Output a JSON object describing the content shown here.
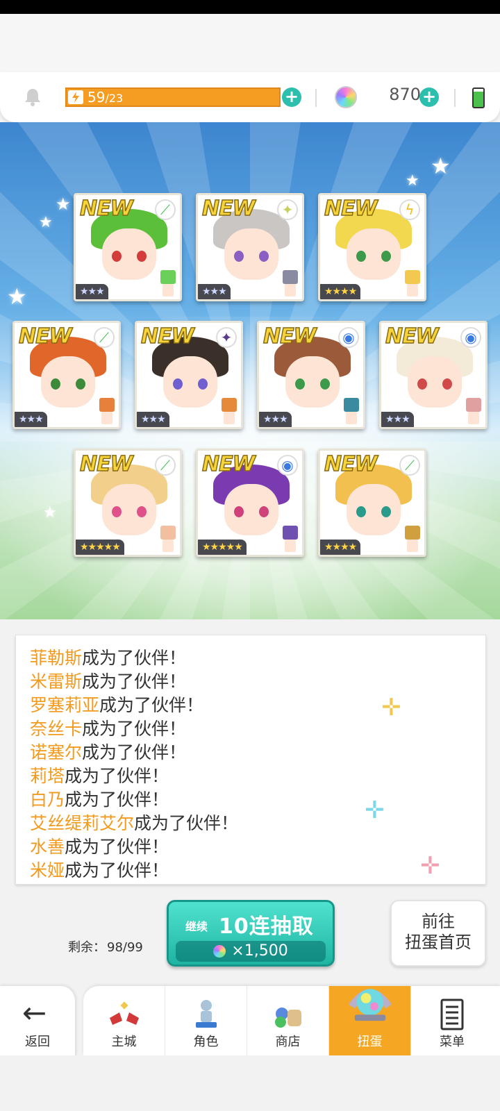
{
  "hud": {
    "energy_current": "59",
    "energy_max": "/23",
    "gem_count": "870",
    "colors": {
      "energy": "#f59d22",
      "plus": "#2dbfae"
    },
    "icons": [
      "bell-icon",
      "lightning-icon",
      "plus-icon",
      "gem-icon",
      "battery-icon"
    ]
  },
  "cards": [
    {
      "new": "NEW",
      "stars": "★★★",
      "element": "leaf",
      "hair": "#5bbf3a",
      "eye": "#d43b3b",
      "sprite": "#6ad05a"
    },
    {
      "new": "NEW",
      "stars": "★★★",
      "element": "sparkle",
      "hair": "#c9c6c4",
      "eye": "#8a5fc4",
      "sprite": "#8a8aa0"
    },
    {
      "new": "NEW",
      "stars": "★★★★",
      "element": "lightning",
      "hair": "#f2d84e",
      "eye": "#3c9a4a",
      "sprite": "#f2c94e"
    },
    {
      "new": "NEW",
      "stars": "★★★",
      "element": "leaf",
      "hair": "#e1662a",
      "eye": "#3c8a3a",
      "sprite": "#e6803a"
    },
    {
      "new": "NEW",
      "stars": "★★★",
      "element": "dark",
      "hair": "#3b2f2a",
      "eye": "#6f5fd0",
      "sprite": "#e58a3a"
    },
    {
      "new": "NEW",
      "stars": "★★★",
      "element": "water",
      "hair": "#9b5a3a",
      "eye": "#3c9a4a",
      "sprite": "#3a8aa0"
    },
    {
      "new": "NEW",
      "stars": "★★★",
      "element": "water",
      "hair": "#f4ead8",
      "eye": "#d04a4a",
      "sprite": "#e0a0a0"
    },
    {
      "new": "NEW",
      "stars": "★★★★★",
      "element": "leaf",
      "hair": "#f2cf8a",
      "eye": "#e0508a",
      "sprite": "#f2c0a0"
    },
    {
      "new": "NEW",
      "stars": "★★★★★",
      "element": "water",
      "hair": "#7a3ab0",
      "eye": "#d0407a",
      "sprite": "#7050b0"
    },
    {
      "new": "NEW",
      "stars": "★★★★",
      "element": "leaf",
      "hair": "#f2c04e",
      "eye": "#2a9a8a",
      "sprite": "#d0a040"
    }
  ],
  "log": [
    {
      "name": "菲勒斯",
      "text": "成为了伙伴！"
    },
    {
      "name": "米雷斯",
      "text": "成为了伙伴！"
    },
    {
      "name": "罗塞莉亚",
      "text": "成为了伙伴！"
    },
    {
      "name": "奈丝卡",
      "text": "成为了伙伴！"
    },
    {
      "name": "诺塞尔",
      "text": "成为了伙伴！"
    },
    {
      "name": "莉塔",
      "text": "成为了伙伴！"
    },
    {
      "name": "白乃",
      "text": "成为了伙伴！"
    },
    {
      "name": "艾丝缇莉艾尔",
      "text": "成为了伙伴！"
    },
    {
      "name": "水善",
      "text": "成为了伙伴！"
    },
    {
      "name": "米娅",
      "text": "成为了伙伴！"
    }
  ],
  "gacha": {
    "remaining_label": "剩余：",
    "remaining_value": "98/99",
    "continue_label": "继续",
    "pull_label": "10连抽取",
    "cost": "×1,500",
    "home_line1": "前往",
    "home_line2": "扭蛋首页"
  },
  "nav": {
    "back": "返回",
    "items": [
      {
        "label": "主城",
        "icon": "castle-icon"
      },
      {
        "label": "角色",
        "icon": "character-icon"
      },
      {
        "label": "商店",
        "icon": "shop-icon"
      },
      {
        "label": "扭蛋",
        "icon": "gacha-icon",
        "active": true
      },
      {
        "label": "菜单",
        "icon": "menu-icon"
      }
    ]
  }
}
